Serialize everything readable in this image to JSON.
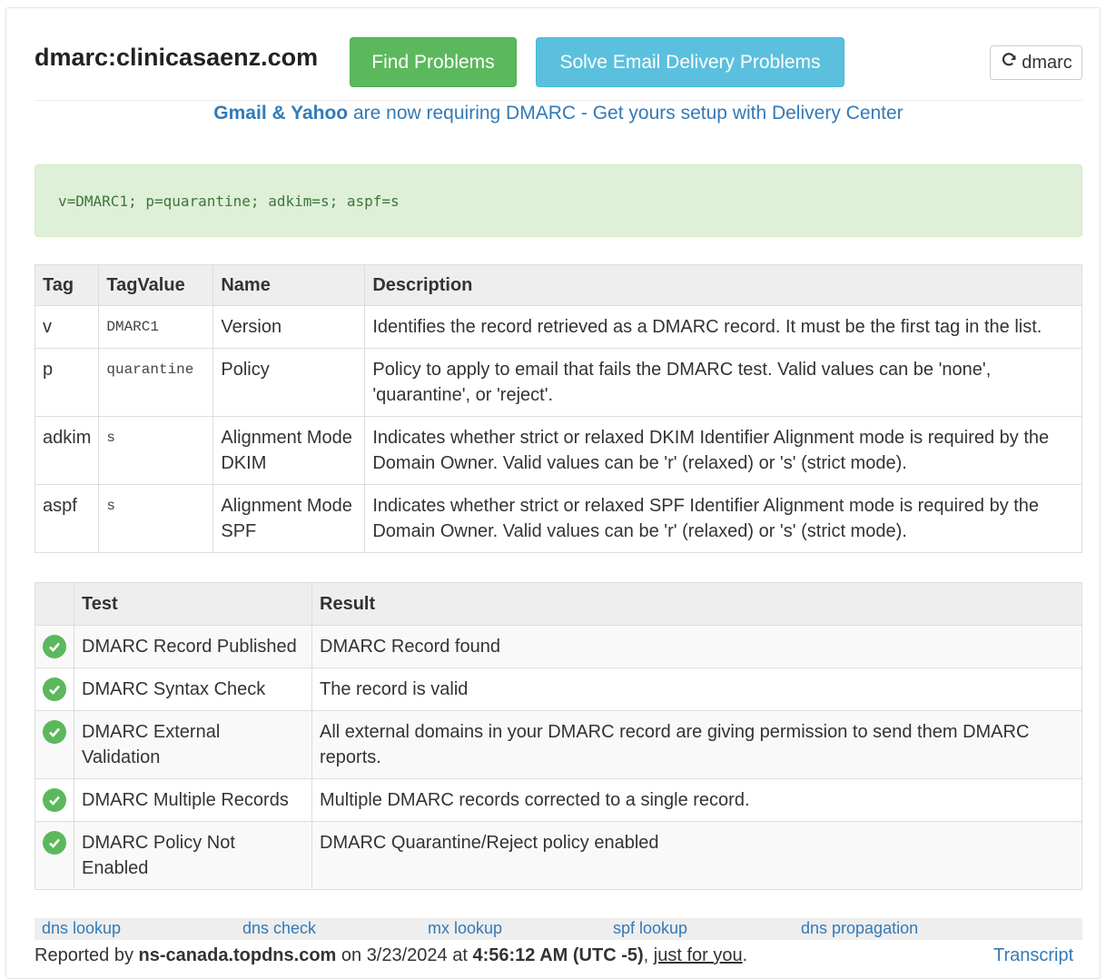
{
  "header": {
    "domain_title": "dmarc:clinicasaenz.com",
    "find_problems_label": "Find Problems",
    "solve_label": "Solve Email Delivery Problems",
    "refresh_label": "dmarc",
    "refresh_icon": "refresh-icon"
  },
  "banner": {
    "bold_text": "Gmail & Yahoo",
    "rest_text": " are now requiring DMARC - Get yours setup with Delivery Center"
  },
  "record": "v=DMARC1; p=quarantine; adkim=s; aspf=s",
  "tag_table": {
    "headers": [
      "Tag",
      "TagValue",
      "Name",
      "Description"
    ],
    "rows": [
      {
        "tag": "v",
        "value": "DMARC1",
        "name": "Version",
        "description": "Identifies the record retrieved as a DMARC record. It must be the first tag in the list."
      },
      {
        "tag": "p",
        "value": "quarantine",
        "name": "Policy",
        "description": "Policy to apply to email that fails the DMARC test. Valid values can be 'none', 'quarantine', or 'reject'."
      },
      {
        "tag": "adkim",
        "value": "s",
        "name": "Alignment Mode DKIM",
        "description": "Indicates whether strict or relaxed DKIM Identifier Alignment mode is required by the Domain Owner. Valid values can be 'r' (relaxed) or 's' (strict mode)."
      },
      {
        "tag": "aspf",
        "value": "s",
        "name": "Alignment Mode SPF",
        "description": "Indicates whether strict or relaxed SPF Identifier Alignment mode is required by the Domain Owner. Valid values can be 'r' (relaxed) or 's' (strict mode)."
      }
    ]
  },
  "test_table": {
    "headers": [
      "",
      "Test",
      "Result"
    ],
    "rows": [
      {
        "status": "pass",
        "test": "DMARC Record Published",
        "result": "DMARC Record found"
      },
      {
        "status": "pass",
        "test": "DMARC Syntax Check",
        "result": "The record is valid"
      },
      {
        "status": "pass",
        "test": "DMARC External Validation",
        "result": "All external domains in your DMARC record are giving permission to send them DMARC reports."
      },
      {
        "status": "pass",
        "test": "DMARC Multiple Records",
        "result": "Multiple DMARC records corrected to a single record."
      },
      {
        "status": "pass",
        "test": "DMARC Policy Not Enabled",
        "result": "DMARC Quarantine/Reject policy enabled"
      }
    ],
    "status_icon": "check-circle-icon",
    "pass_color": "#5cb85c"
  },
  "footer_links": [
    "dns lookup",
    "dns check",
    "mx lookup",
    "spf lookup",
    "dns propagation"
  ],
  "report": {
    "prefix": "Reported by ",
    "server": "ns-canada.topdns.com",
    "on": " on 3/23/2024 at ",
    "time": "4:56:12 AM (UTC -5)",
    "comma": ", ",
    "just_for_you": "just for you",
    "period": "."
  },
  "transcript_label": "Transcript",
  "colors": {
    "link": "#337ab7",
    "success_button": "#5cb85c",
    "info_button": "#5bc0de",
    "record_bg": "#dff0d8",
    "record_text": "#3c763d"
  }
}
